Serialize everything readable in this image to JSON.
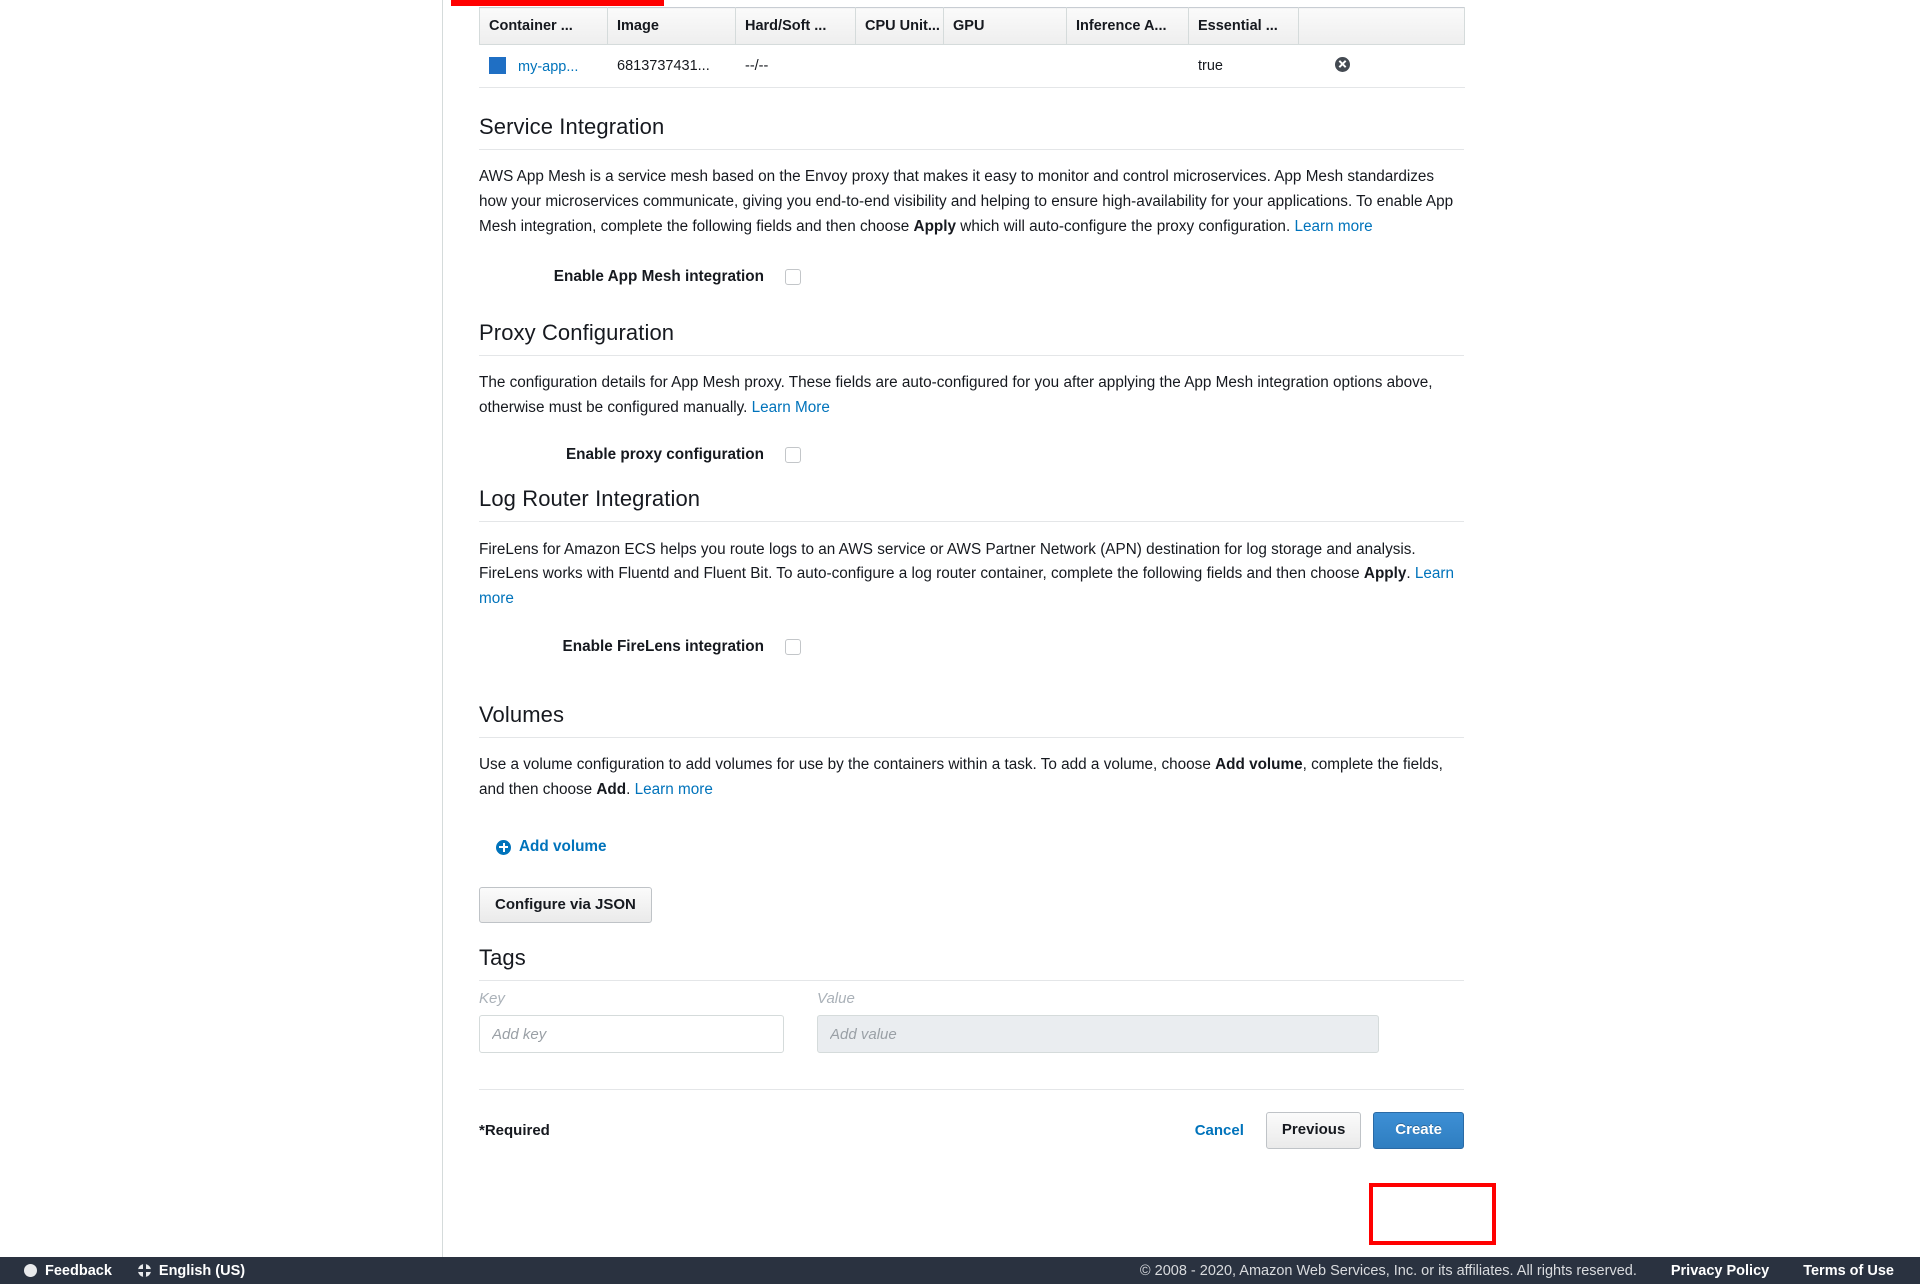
{
  "container_table": {
    "columns": [
      "Container ...",
      "Image",
      "Hard/Soft ...",
      "CPU Unit...",
      "GPU",
      "Inference A...",
      "Essential ...",
      ""
    ],
    "rows": [
      {
        "name": "my-app...",
        "image": "6813737431...",
        "memory": "--/--",
        "cpu": "",
        "gpu": "",
        "inference": "",
        "essential": "true",
        "remove_icon": "remove-circle-icon"
      }
    ]
  },
  "service_integration": {
    "title": "Service Integration",
    "body_part1": "AWS App Mesh is a service mesh based on the Envoy proxy that makes it easy to monitor and control microservices. App Mesh standardizes how your microservices communicate, giving you end-to-end visibility and helping to ensure high-availability for your applications. To enable App Mesh integration, complete the following fields and then choose ",
    "body_bold": "Apply",
    "body_part2": " which will auto-configure the proxy configuration. ",
    "learn_more": "Learn more",
    "checkbox_label": "Enable App Mesh integration",
    "checkbox_checked": false
  },
  "proxy_configuration": {
    "title": "Proxy Configuration",
    "body": "The configuration details for App Mesh proxy. These fields are auto-configured for you after applying the App Mesh integration options above, otherwise must be configured manually. ",
    "learn_more": "Learn More",
    "checkbox_label": "Enable proxy configuration",
    "checkbox_checked": false
  },
  "log_router_integration": {
    "title": "Log Router Integration",
    "body_part1": "FireLens for Amazon ECS helps you route logs to an AWS service or AWS Partner Network (APN) destination for log storage and analysis. FireLens works with Fluentd and Fluent Bit. To auto-configure a log router container, complete the following fields and then choose ",
    "body_bold": "Apply",
    "body_part2": ". ",
    "learn_more": "Learn more",
    "checkbox_label": "Enable FireLens integration",
    "checkbox_checked": false
  },
  "volumes": {
    "title": "Volumes",
    "body_part1": "Use a volume configuration to add volumes for use by the containers within a task. To add a volume, choose ",
    "body_bold1": "Add volume",
    "body_part2": ", complete the fields, and then choose ",
    "body_bold2": "Add",
    "body_part3": ". ",
    "learn_more": "Learn more",
    "add_volume_label": "Add volume",
    "configure_json_label": "Configure via JSON"
  },
  "tags": {
    "title": "Tags",
    "key_header": "Key",
    "value_header": "Value",
    "key_placeholder": "Add key",
    "value_placeholder": "Add value",
    "key_value": "",
    "value_value": ""
  },
  "actions": {
    "required_note": "*Required",
    "cancel": "Cancel",
    "previous": "Previous",
    "create": "Create"
  },
  "footer": {
    "feedback": "Feedback",
    "language": "English (US)",
    "copyright": "© 2008 - 2020, Amazon Web Services, Inc. or its affiliates. All rights reserved.",
    "privacy": "Privacy Policy",
    "terms": "Terms of Use"
  },
  "annotations": {
    "highlight_color": "#ff0000",
    "create_button_highlight": true,
    "top_bar_highlight": true
  }
}
